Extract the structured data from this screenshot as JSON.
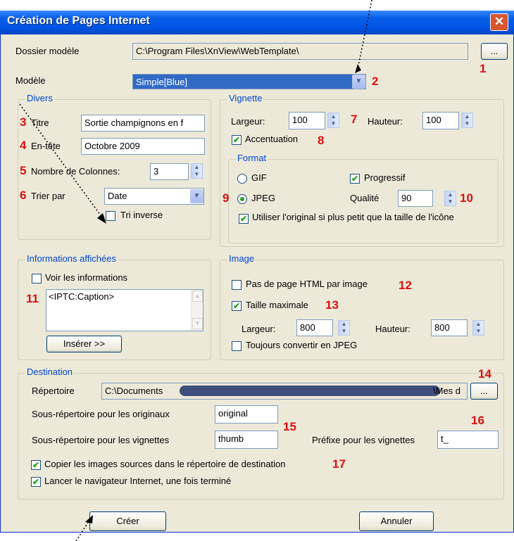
{
  "window": {
    "title": "Création de Pages Internet",
    "close": "✕"
  },
  "template": {
    "folder_label": "Dossier modèle",
    "folder_value": "C:\\Program Files\\XnView\\WebTemplate\\",
    "browse": "...",
    "model_label": "Modèle",
    "model_value": "Simple[Blue]"
  },
  "divers": {
    "title": "Divers",
    "titre_label": "Titre",
    "titre_value": "Sortie champignons en f",
    "entete_label": "En-tête",
    "entete_value": "Octobre 2009",
    "cols_label": "Nombre de Colonnes:",
    "cols_value": "3",
    "sort_label": "Trier par",
    "sort_value": "Date",
    "reverse_label": "Tri inverse"
  },
  "vignette": {
    "title": "Vignette",
    "width_label": "Largeur:",
    "width_value": "100",
    "height_label": "Hauteur:",
    "height_value": "100",
    "sharpen_label": "Accentuation",
    "format_title": "Format",
    "gif_label": "GIF",
    "progressive_label": "Progressif",
    "jpeg_label": "JPEG",
    "quality_label": "Qualité",
    "quality_value": "90",
    "original_label": "Utiliser l'original si plus petit que la taille de l'icône"
  },
  "info": {
    "title": "Informations affichées",
    "show_label": "Voir les informations",
    "text": "<IPTC:Caption>",
    "insert": "Insérer >>"
  },
  "image": {
    "title": "Image",
    "nohtml_label": "Pas de page HTML par image",
    "maxsize_label": "Taille maximale",
    "width_label": "Largeur:",
    "width_value": "800",
    "height_label": "Hauteur:",
    "height_value": "800",
    "convert_label": "Toujours convertir en JPEG"
  },
  "dest": {
    "title": "Destination",
    "dir_label": "Répertoire",
    "dir_value_start": "C:\\Documents",
    "dir_value_end": "\\Mes d",
    "browse": "...",
    "orig_label": "Sous-répertoire pour les originaux",
    "orig_value": "original",
    "thumb_label": "Sous-répertoire pour les vignettes",
    "thumb_value": "thumb",
    "prefix_label": "Préfixe pour les vignettes",
    "prefix_value": "t_",
    "copy_label": "Copier les images sources dans le répertoire de destination",
    "launch_label": "Lancer le navigateur Internet, une fois terminé"
  },
  "buttons": {
    "create": "Créer",
    "cancel": "Annuler"
  },
  "annotations": [
    "1",
    "2",
    "3",
    "4",
    "5",
    "6",
    "7",
    "8",
    "9",
    "10",
    "11",
    "12",
    "13",
    "14",
    "15",
    "16",
    "17"
  ],
  "colors": {
    "accent": "#0054e3",
    "annotation": "#dd1010",
    "group_title": "#0046d5"
  },
  "icons": {
    "check": "✔",
    "spin_up": "▲",
    "spin_down": "▼",
    "dropdown": "▼"
  }
}
